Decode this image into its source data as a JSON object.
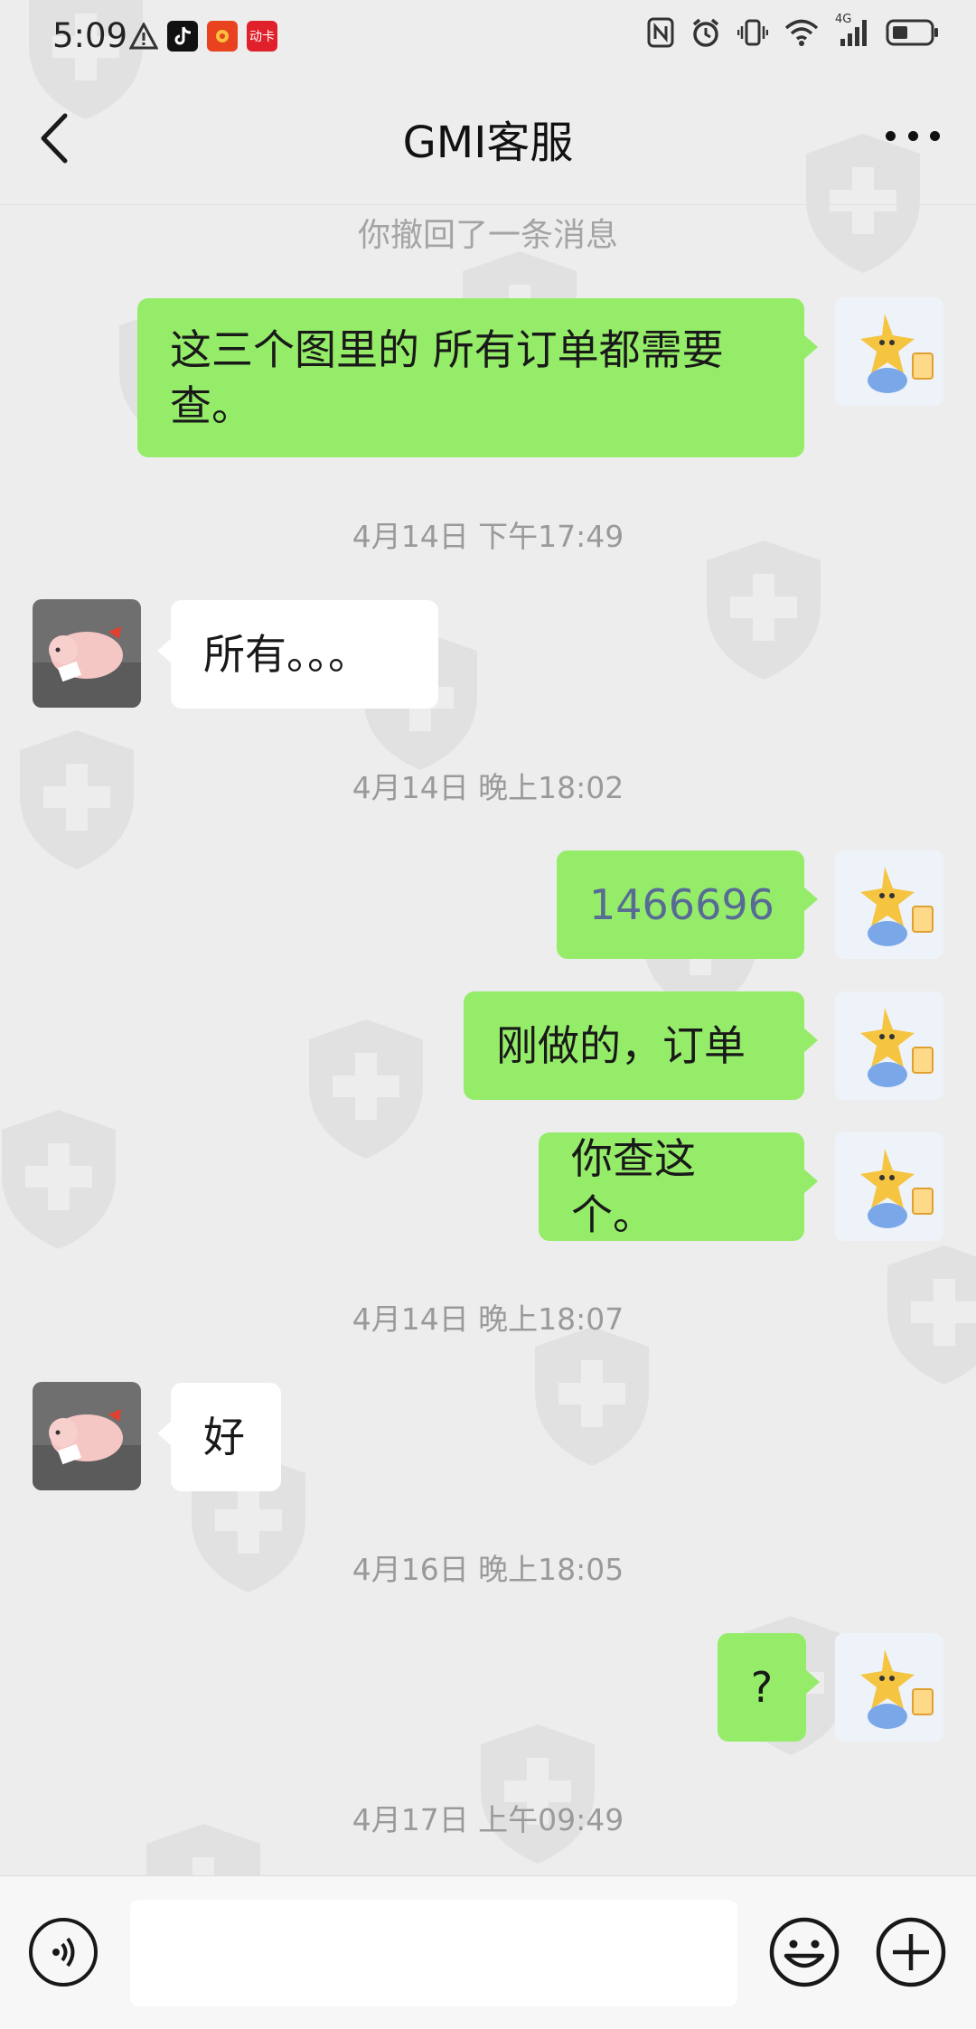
{
  "status_bar": {
    "time": "5:09",
    "left_icons": [
      "warning-icon",
      "tiktok-icon",
      "red-envelope-icon",
      "app-badge-icon"
    ],
    "app_badge_text": "动卡",
    "right_icons": [
      "nfc-icon",
      "alarm-icon",
      "vibrate-icon",
      "wifi-icon",
      "signal-4g-icon",
      "battery-icon"
    ],
    "network_label": "4G"
  },
  "nav": {
    "title": "GMI客服"
  },
  "chat": {
    "system_notice": "你撤回了一条消息",
    "messages": [
      {
        "from": "me",
        "text": "这三个图里的 所有订单都需要查。"
      },
      {
        "type": "timestamp",
        "text": "4月14日 下午17:49"
      },
      {
        "from": "them",
        "text": "所有。。。"
      },
      {
        "type": "timestamp",
        "text": "4月14日 晚上18:02"
      },
      {
        "from": "me",
        "text": "1466696",
        "link": true
      },
      {
        "from": "me",
        "text": "刚做的，订单"
      },
      {
        "from": "me",
        "text": "你查这个。"
      },
      {
        "type": "timestamp",
        "text": "4月14日 晚上18:07"
      },
      {
        "from": "them",
        "text": "好"
      },
      {
        "type": "timestamp",
        "text": "4月16日 晚上18:05"
      },
      {
        "from": "me",
        "text": "?"
      },
      {
        "type": "timestamp",
        "text": "4月17日 上午09:49"
      }
    ]
  },
  "input": {
    "placeholder": "",
    "value": ""
  },
  "colors": {
    "my_bubble": "#95ec69",
    "their_bubble": "#ffffff",
    "background": "#ededed",
    "link": "#576b95"
  }
}
